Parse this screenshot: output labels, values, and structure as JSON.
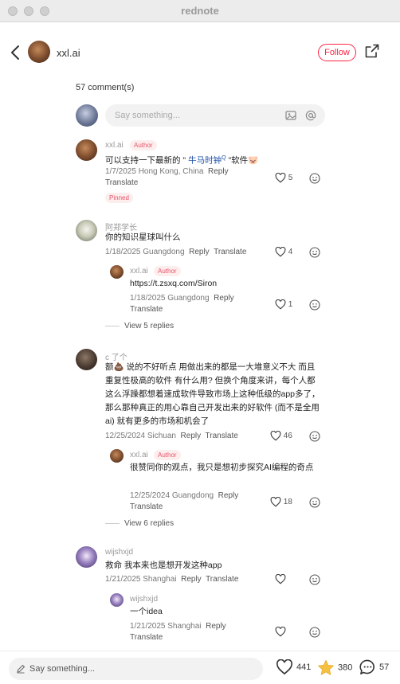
{
  "app": {
    "title": "rednote"
  },
  "header": {
    "author_name": "xxl.ai",
    "follow_label": "Follow"
  },
  "comments_section": {
    "count_label": "57 comment(s)",
    "input_placeholder": "Say something..."
  },
  "comments": [
    {
      "name": "xxl.ai",
      "badge": "Author",
      "text_before": "可以支持一下最新的 \"",
      "link": " 牛马时钟",
      "link_sup": "Q",
      "text_after": " \"软件🐷",
      "date_loc": "1/7/2025 Hong Kong, China",
      "reply": "Reply",
      "translate": "Translate",
      "likes": "5",
      "pinned": "Pinned"
    },
    {
      "name": "阿郑学长",
      "text": "你的知识星球叫什么",
      "date_loc": "1/18/2025 Guangdong",
      "reply": "Reply",
      "translate": "Translate",
      "likes": "4",
      "sub": {
        "name": "xxl.ai",
        "badge": "Author",
        "text": "https://t.zsxq.com/Siron",
        "date_loc": "1/18/2025 Guangdong",
        "reply": "Reply",
        "translate": "Translate",
        "likes": "1"
      },
      "view_replies": "View 5 replies"
    },
    {
      "name": "c 了个",
      "text": "额💩 说的不好听点 用做出来的都是一大堆意义不大 而且重复性极高的软件 有什么用? 但换个角度来讲，每个人都这么浮躁都想着速成软件导致市场上这种低级的app多了，那么那种真正的用心靠自己开发出来的好软件 (而不是全用ai) 就有更多的市场和机会了",
      "date_loc": "12/25/2024 Sichuan",
      "reply": "Reply",
      "translate": "Translate",
      "likes": "46",
      "sub": {
        "name": "xxl.ai",
        "badge": "Author",
        "text": "很赞同你的观点，我只是想初步探究AI编程的奇点",
        "date_loc": "12/25/2024 Guangdong",
        "reply": "Reply",
        "translate": "Translate",
        "likes": "18"
      },
      "view_replies": "View 6 replies"
    },
    {
      "name": "wijshxjd",
      "text": "救命 我本来也是想开发这种app",
      "date_loc": "1/21/2025 Shanghai",
      "reply": "Reply",
      "translate": "Translate",
      "sub": {
        "name": "wijshxjd",
        "text": "一个idea",
        "date_loc": "1/21/2025 Shanghai",
        "reply": "Reply",
        "translate": "Translate"
      }
    }
  ],
  "bottom_bar": {
    "placeholder": "Say something...",
    "likes": "441",
    "stars": "380",
    "comments": "57"
  },
  "colors": {
    "accent": "#ff2442",
    "link": "#1e4fa8",
    "star": "#f6c143"
  }
}
